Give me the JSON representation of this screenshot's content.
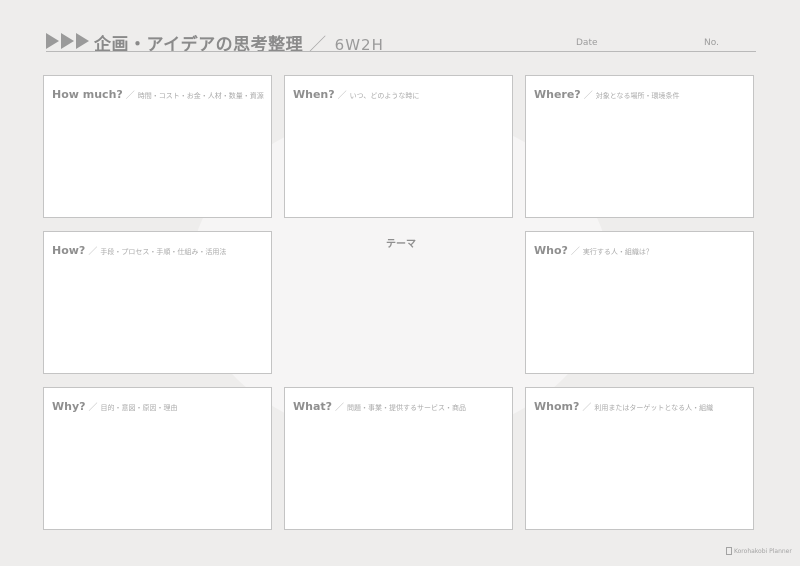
{
  "header": {
    "title": "企画・アイデアの思考整理",
    "separator": "／",
    "subtitle": "6W2H",
    "date_label": "Date",
    "no_label": "No."
  },
  "theme": {
    "label": "テーマ"
  },
  "boxes": [
    {
      "question": "How much?",
      "separator": "／",
      "hint": "時間・コスト・お金・人材・数量・資源"
    },
    {
      "question": "When?",
      "separator": "／",
      "hint": "いつ、どのような時に"
    },
    {
      "question": "Where?",
      "separator": "／",
      "hint": "対象となる場所・環境条件"
    },
    {
      "question": "How?",
      "separator": "／",
      "hint": "手段・プロセス・手順・仕組み・活用法"
    },
    {
      "question": "Who?",
      "separator": "／",
      "hint": "実行する人・組織は？"
    },
    {
      "question": "Why?",
      "separator": "／",
      "hint": "目的・意図・原因・理由"
    },
    {
      "question": "What?",
      "separator": "／",
      "hint": "問題・事業・提供するサービス・商品"
    },
    {
      "question": "Whom?",
      "separator": "／",
      "hint": "利用またはターゲットとなる人・組織"
    }
  ],
  "footer": {
    "brand": "Korohakobi Planner"
  }
}
